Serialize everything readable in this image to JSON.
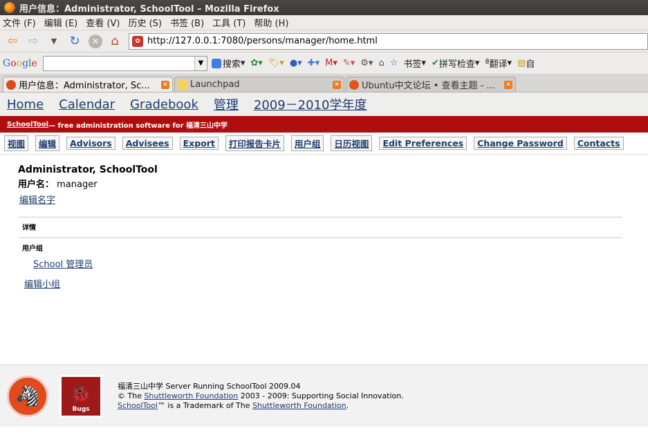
{
  "window": {
    "title": "用户信息：Administrator, SchoolTool – Mozilla Firefox"
  },
  "menu": [
    "文件 (F)",
    "编辑 (E)",
    "查看 (V)",
    "历史 (S)",
    "书签 (B)",
    "工具 (T)",
    "帮助 (H)"
  ],
  "url": "http://127.0.0.1:7080/persons/manager/home.html",
  "google": {
    "search_value": ""
  },
  "toolbar2": [
    "搜索",
    "书签",
    "拼写检查",
    "翻译",
    "自"
  ],
  "tabs": [
    {
      "label": "用户信息：Administrator, Sc...",
      "active": true
    },
    {
      "label": "Launchpad",
      "active": false
    },
    {
      "label": "Ubuntu中文论坛 • 查看主题 - ...",
      "active": false
    }
  ],
  "sitenav": [
    "Home",
    "Calendar",
    "Gradebook",
    "管理",
    "2009－2010学年度"
  ],
  "redbar": {
    "link": "SchoolTool",
    "text": " — free administration software for 福清三山中学"
  },
  "actions": [
    "视图",
    "编辑",
    "Advisors",
    "Advisees",
    "Export",
    "打印报告卡片",
    "用户组",
    "日历视图",
    "Edit Preferences",
    "Change Password",
    "Contacts"
  ],
  "person": {
    "full_name": "Administrator, SchoolTool",
    "username_label": "用户名：",
    "username": "manager",
    "edit_name": "编辑名字"
  },
  "details": {
    "heading": "详情"
  },
  "groups": {
    "heading": "用户组",
    "items": [
      "School 管理员"
    ],
    "edit": "编辑小组"
  },
  "footer": {
    "line1": "福清三山中学 Server Running SchoolTool 2009.04",
    "line2_pre": "© The ",
    "line2_link": "Shuttleworth Foundation",
    "line2_post": " 2003 - 2009: Supporting Social Innovation.",
    "line3_link1": "SchoolTool",
    "line3_mid": "™ is a Trademark of The ",
    "line3_link2": "Shuttleworth Foundation",
    "line3_post": ".",
    "bugs_label": "Bugs"
  }
}
